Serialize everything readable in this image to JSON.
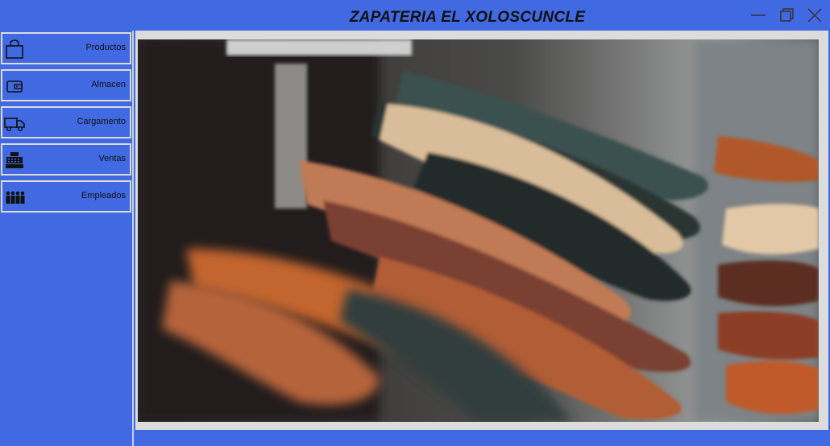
{
  "window": {
    "title": "ZAPATERIA EL XOLOSCUNCLE",
    "controls": [
      "minimize-icon",
      "maximize-icon",
      "close-icon"
    ]
  },
  "colors": {
    "background": "#4169e1",
    "button_border": "#dcdcdc",
    "content_panel": "#dcdcdc"
  },
  "sidebar": {
    "items": [
      {
        "label": "Productos",
        "icon": "shopping-bag-icon"
      },
      {
        "label": "Almacen",
        "icon": "wallet-icon"
      },
      {
        "label": "Cargamento",
        "icon": "truck-icon"
      },
      {
        "label": "Ventas",
        "icon": "cash-register-icon"
      },
      {
        "label": "Empleados",
        "icon": "people-icon"
      }
    ]
  },
  "main": {
    "image": "shoes-photo"
  }
}
